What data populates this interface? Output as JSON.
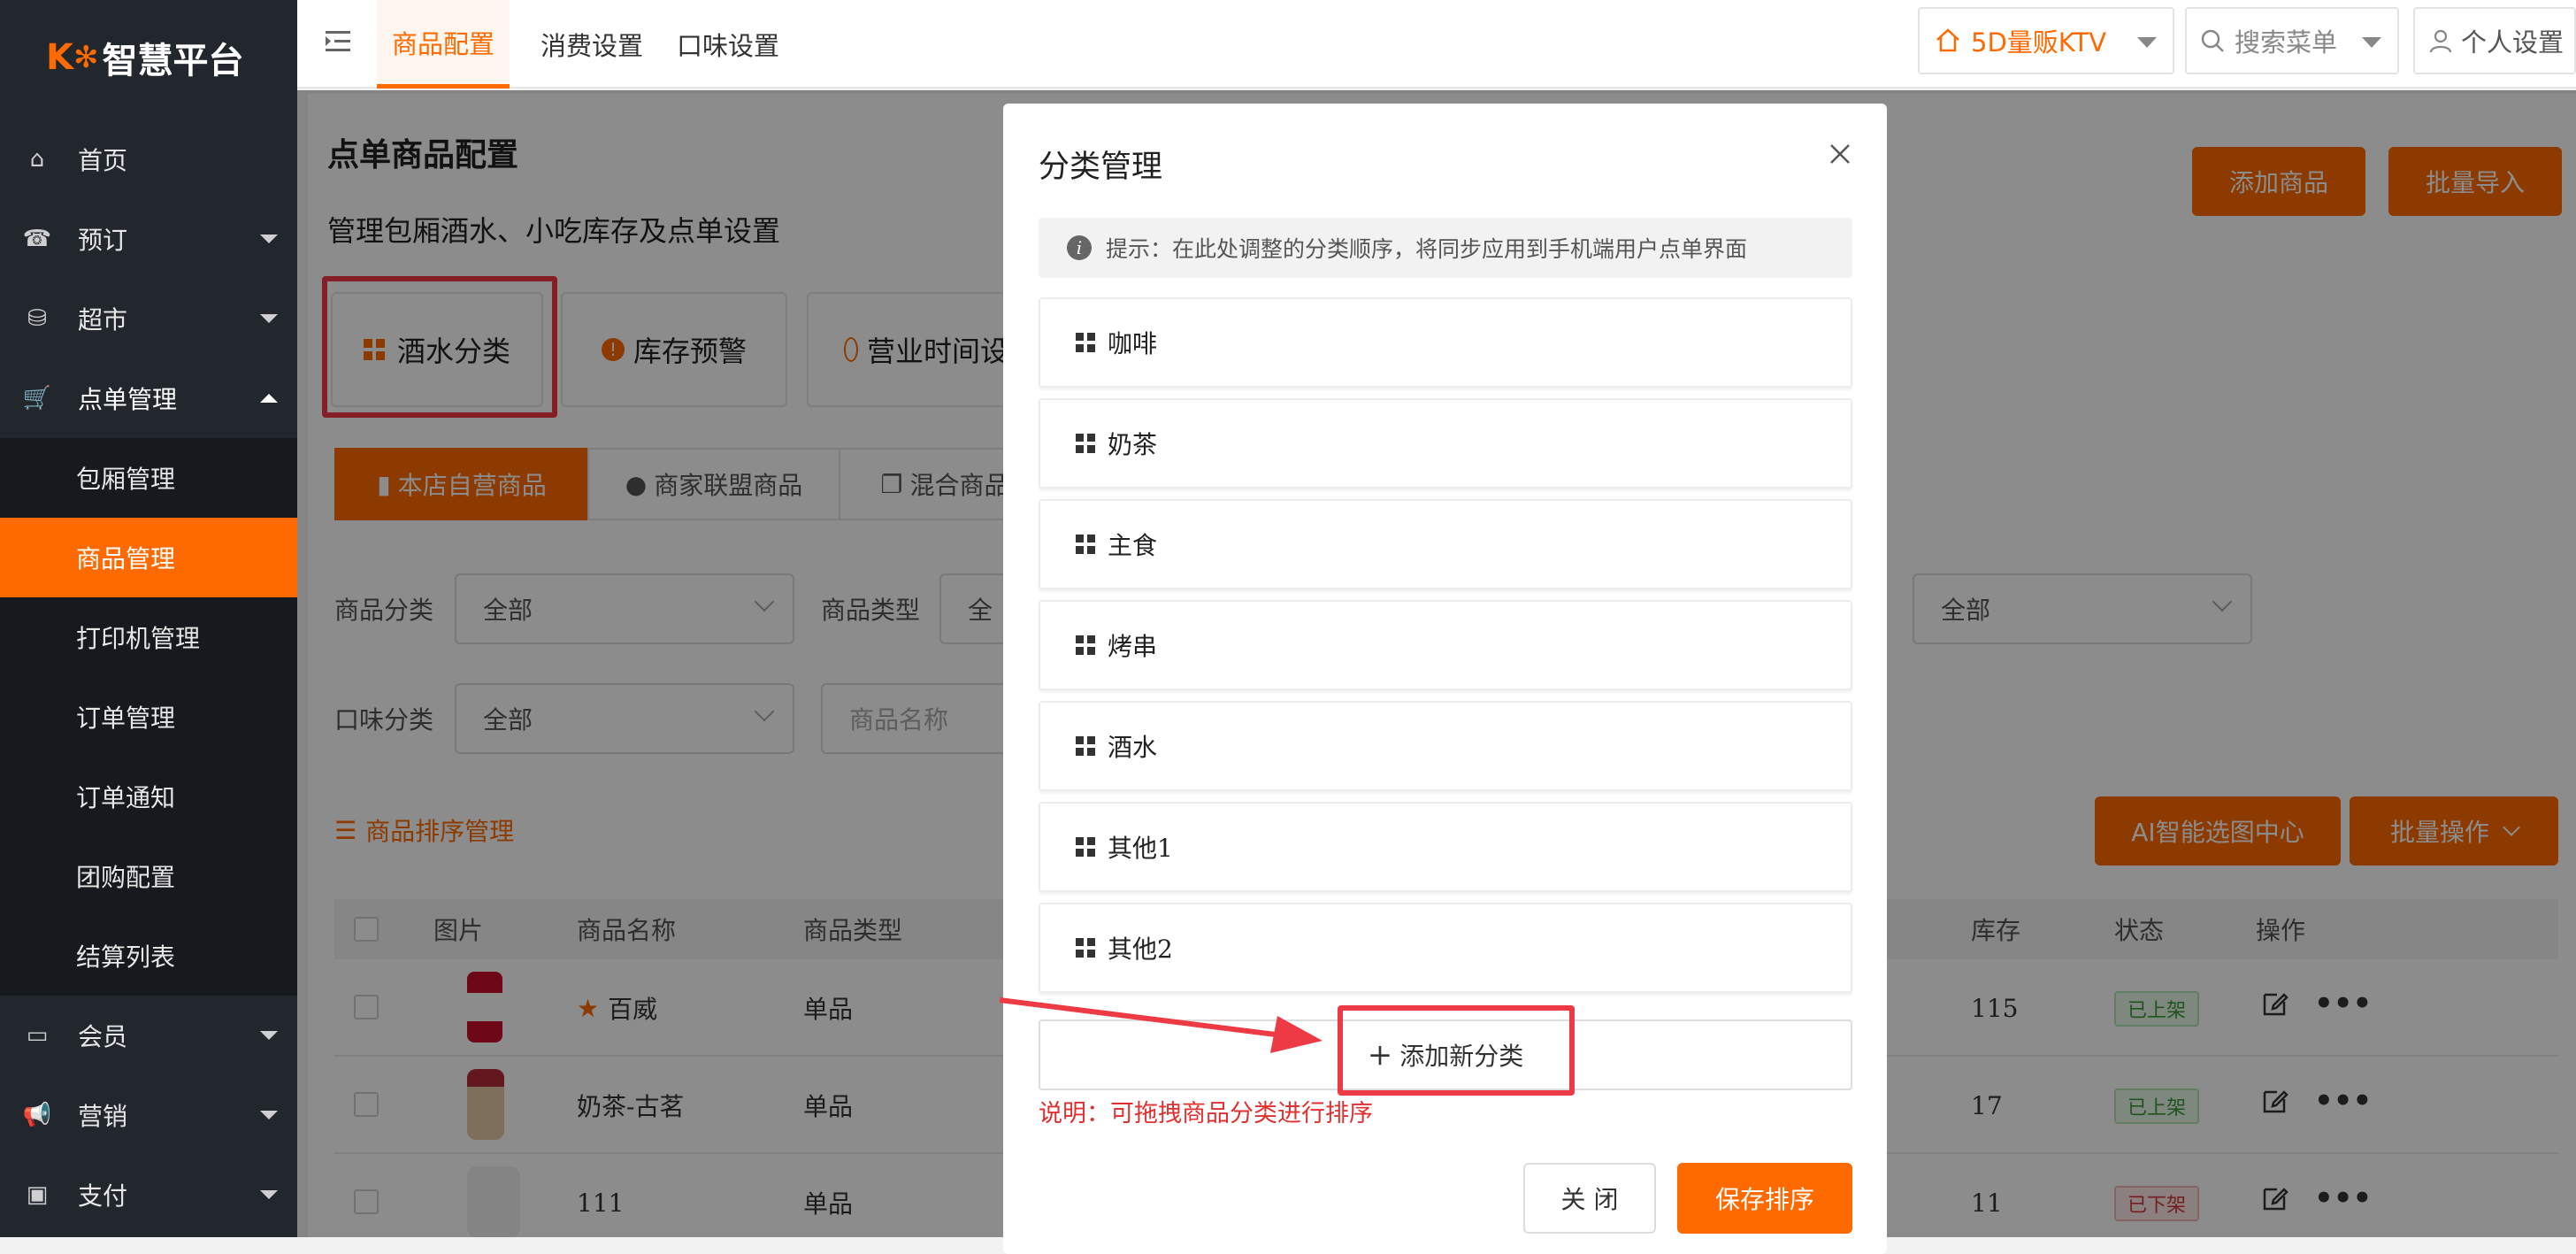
{
  "brand": {
    "logo_prefix": "K",
    "logo_mark": "✻",
    "logo_text": "智慧平台"
  },
  "sidebar": {
    "items": [
      {
        "label": "首页",
        "icon": "home-icon"
      },
      {
        "label": "预订",
        "icon": "booking-icon"
      },
      {
        "label": "超市",
        "icon": "basket-icon"
      },
      {
        "label": "点单管理",
        "icon": "cart-icon"
      }
    ],
    "submenu": [
      {
        "label": "包厢管理"
      },
      {
        "label": "商品管理"
      },
      {
        "label": "打印机管理"
      },
      {
        "label": "订单管理"
      },
      {
        "label": "订单通知"
      },
      {
        "label": "团购配置"
      },
      {
        "label": "结算列表"
      }
    ],
    "lower_items": [
      {
        "label": "会员",
        "icon": "card-icon"
      },
      {
        "label": "营销",
        "icon": "megaphone-icon"
      },
      {
        "label": "支付",
        "icon": "money-icon"
      }
    ]
  },
  "topbar": {
    "tabs": [
      "商品配置",
      "消费设置",
      "口味设置"
    ],
    "store": "5D量贩KTV",
    "search_placeholder": "搜索菜单",
    "personal": "个人设置"
  },
  "page": {
    "title": "点单商品配置",
    "subtitle": "管理包厢酒水、小吃库存及点单设置",
    "add_button": "添加商品",
    "import_button": "批量导入",
    "cards": [
      "酒水分类",
      "库存预警",
      "营业时间设"
    ],
    "seg_tabs": [
      "本店自营商品",
      "商家联盟商品",
      "混合商品"
    ],
    "filter": {
      "category_label": "商品分类",
      "category_value": "全部",
      "type_label": "商品类型",
      "type_value": "全",
      "third_value": "全部",
      "taste_label": "口味分类",
      "taste_value": "全部",
      "name_placeholder": "商品名称"
    },
    "sort_link": "商品排序管理",
    "ai_button": "AI智能选图中心",
    "batch_button": "批量操作"
  },
  "table": {
    "headers": {
      "image": "图片",
      "name": "商品名称",
      "type": "商品类型",
      "stock": "库存",
      "status": "状态",
      "action": "操作"
    },
    "rows": [
      {
        "name": "百威",
        "type": "单品",
        "stock": "115",
        "status": "已上架",
        "starred": true
      },
      {
        "name": "奶茶-古茗",
        "type": "单品",
        "stock": "17",
        "status": "已上架",
        "starred": false
      },
      {
        "name": "111",
        "type": "单品",
        "stock": "11",
        "status": "已下架",
        "starred": false
      }
    ]
  },
  "modal": {
    "title": "分类管理",
    "tip": "提示：在此处调整的分类顺序，将同步应用到手机端用户点单界面",
    "categories": [
      "咖啡",
      "奶茶",
      "主食",
      "烤串",
      "酒水",
      "其他1",
      "其他2"
    ],
    "add_label": "添加新分类",
    "note": "说明：可拖拽商品分类进行排序",
    "close_button": "关 闭",
    "save_button": "保存排序"
  },
  "colors": {
    "accent": "#ff6a00",
    "sidebar": "#22272d",
    "annotation": "#ee3a44"
  }
}
